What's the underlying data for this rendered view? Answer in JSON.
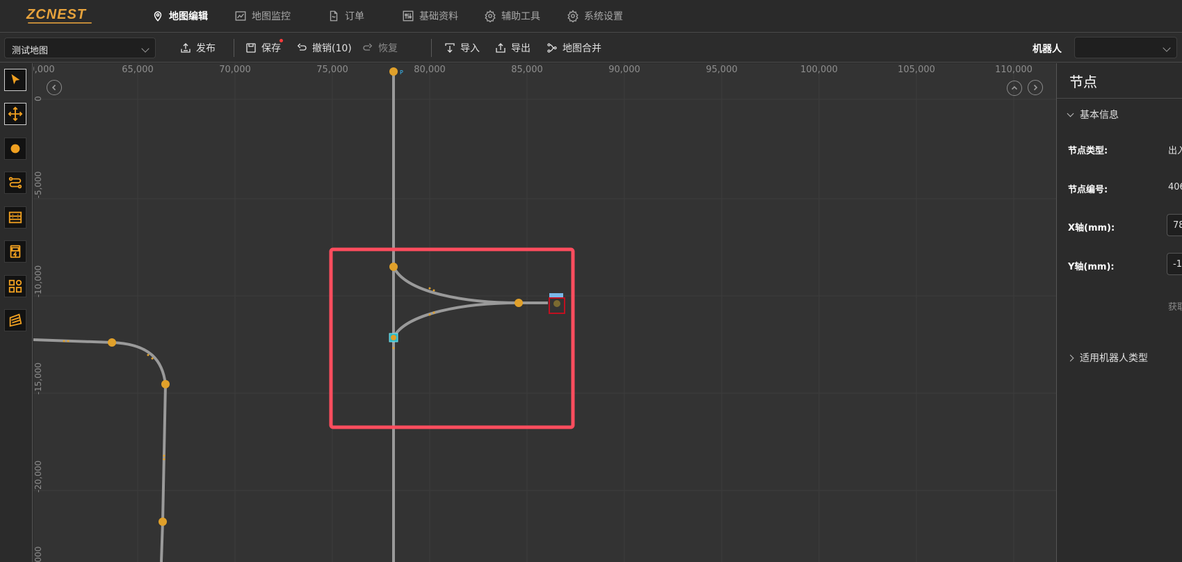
{
  "brand": {
    "logo_text": "ZCNEST",
    "accent": "#e6a23c"
  },
  "nav": {
    "items": [
      {
        "label": "地图编辑",
        "icon": "map-pin-icon",
        "active": true
      },
      {
        "label": "地图监控",
        "icon": "chart-line-icon",
        "active": false
      },
      {
        "label": "订单",
        "icon": "document-icon",
        "active": false
      },
      {
        "label": "基础资料",
        "icon": "sliders-icon",
        "active": false
      },
      {
        "label": "辅助工具",
        "icon": "gear-icon",
        "active": false
      },
      {
        "label": "系统设置",
        "icon": "gear-icon",
        "active": false
      }
    ]
  },
  "toolbar": {
    "map_select_value": "测试地图",
    "publish_label": "发布",
    "save_label": "保存",
    "undo_label": "撤销(10)",
    "redo_label": "恢复",
    "import_label": "导入",
    "export_label": "导出",
    "merge_label": "地图合并",
    "robot_label": "机器人",
    "robot_select_value": ""
  },
  "left_tools": [
    {
      "name": "select-tool",
      "icon": "cursor-icon"
    },
    {
      "name": "move-tool",
      "icon": "move-arrows-icon"
    },
    {
      "name": "node-tool",
      "icon": "node-dot-icon"
    },
    {
      "name": "path-tool",
      "icon": "path-route-icon"
    },
    {
      "name": "shelf-tool",
      "icon": "shelf-icon"
    },
    {
      "name": "charger-tool",
      "icon": "charger-icon"
    },
    {
      "name": "component-tool",
      "icon": "components-icon"
    },
    {
      "name": "area-tool",
      "icon": "area-icon"
    }
  ],
  "canvas": {
    "x_ticks": [
      "0,000",
      "65,000",
      "70,000",
      "75,000",
      "80,000",
      "85,000",
      "90,000",
      "95,000",
      "100,000",
      "105,000",
      "110,000"
    ],
    "y_ticks": [
      "0",
      "-5,000",
      "-10,000",
      "-15,000",
      "-20,000",
      "000"
    ],
    "point_marker": "P",
    "path_color": "#9a9a9a",
    "node_color": "#e0a02a",
    "highlight_color": "#ff4d5e"
  },
  "right_panel": {
    "title": "节点",
    "basic_info_label": "基本信息",
    "node_type_label": "节点类型:",
    "node_type_value": "出入",
    "node_id_label": "节点编号:",
    "node_id_value": "406",
    "x_label": "X轴(mm):",
    "x_value": "78",
    "y_label": "Y轴(mm):",
    "y_value": "-1",
    "fetch_label": "获取",
    "robot_types_label": "适用机器人类型"
  }
}
